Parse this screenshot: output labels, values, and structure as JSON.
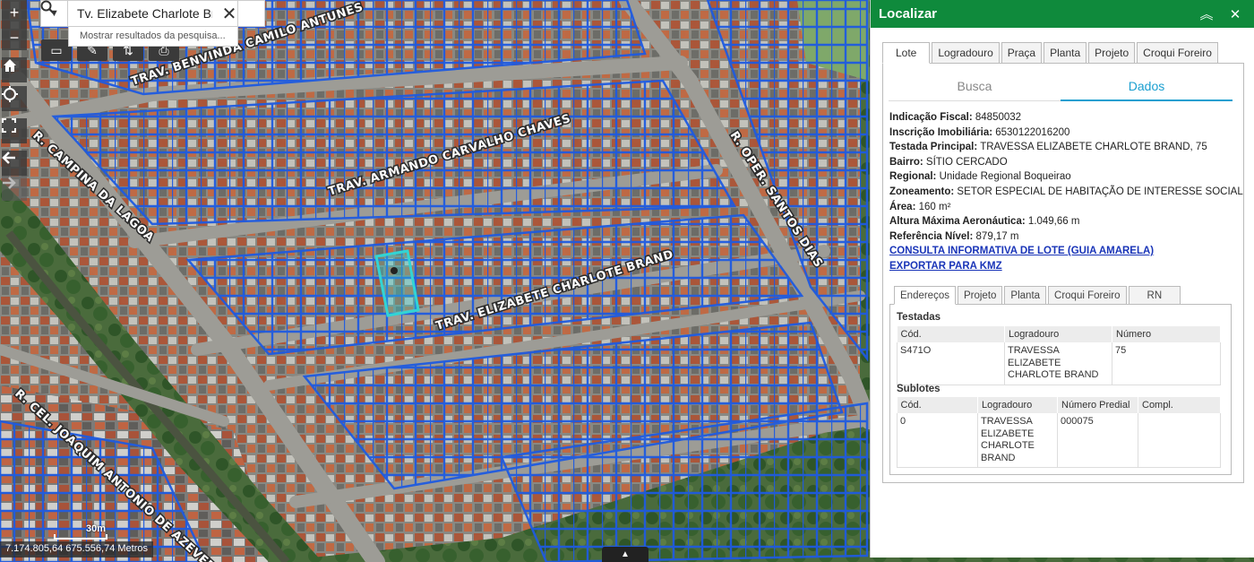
{
  "map": {
    "road_labels": {
      "benvinda": "TRAV. BENVINDA CAMILO ANTUNES",
      "armando": "TRAV. ARMANDO CARVALHO CHAVES",
      "elizabete": "TRAV. ELIZABETE CHARLOTE BRAND",
      "campina": "R. CAMPINA DA LAGOA",
      "oper": "R. OPER. SANTOS DIAS",
      "joaquim": "R. CEL. JOAQUIM ANTONIO DE AZEVEDO"
    },
    "colors": {
      "parcel_line": "#1f5be0",
      "selected_parcel": "#32d4d4",
      "road": "#9a9a94",
      "vegetation": "#3f6b3a"
    }
  },
  "search": {
    "value": "Tv. Elizabete Charlote Bran",
    "hint": "Mostrar resultados da pesquisa..."
  },
  "toolbar": {
    "zoom_in": "+",
    "zoom_out": "−",
    "icons": [
      "home-icon",
      "locate-icon",
      "fullscreen-icon",
      "back-arrow-icon",
      "forward-arrow-icon"
    ]
  },
  "footer": {
    "coords": "7.174.805,64 675.556,74 Metros",
    "scale": "30m",
    "attr_toggle": "▲"
  },
  "panel": {
    "title": "Localizar",
    "tabs": [
      "Lote",
      "Logradouro",
      "Praça",
      "Planta",
      "Projeto",
      "Croqui Foreiro"
    ],
    "subtabs": [
      "Busca",
      "Dados"
    ],
    "fields": [
      {
        "label": "Indicação Fiscal:",
        "value": "84850032"
      },
      {
        "label": "Inscrição Imobiliária:",
        "value": "6530122016200"
      },
      {
        "label": "Testada Principal:",
        "value": "TRAVESSA ELIZABETE CHARLOTE BRAND, 75"
      },
      {
        "label": "Bairro:",
        "value": "SÍTIO CERCADO"
      },
      {
        "label": "Regional:",
        "value": "Unidade Regional Boqueirao"
      },
      {
        "label": "Zoneamento:",
        "value": "SETOR ESPECIAL DE HABITAÇÃO DE INTERESSE SOCIAL"
      },
      {
        "label": "Área:",
        "value": "160 m²"
      },
      {
        "label": "Altura Máxima Aeronáutica:",
        "value": "1.049,66 m"
      },
      {
        "label": "Referência Nível:",
        "value": "879,17 m"
      }
    ],
    "links": [
      "CONSULTA INFORMATIVA DE LOTE (GUIA AMARELA)",
      "EXPORTAR PARA KMZ"
    ],
    "inner_tabs": [
      "Endereços",
      "Projeto",
      "Planta",
      "Croqui Foreiro",
      "RN"
    ],
    "testadas": {
      "title": "Testadas",
      "headers": [
        "Cód.",
        "Logradouro",
        "Número"
      ],
      "rows": [
        [
          "S471O",
          "TRAVESSA ELIZABETE CHARLOTE BRAND",
          "75"
        ]
      ]
    },
    "sublotes": {
      "title": "Sublotes",
      "headers": [
        "Cód.",
        "Logradouro",
        "Número Predial",
        "Compl."
      ],
      "rows": [
        [
          "0",
          "TRAVESSA ELIZABETE CHARLOTE BRAND",
          "000075",
          ""
        ]
      ]
    }
  }
}
